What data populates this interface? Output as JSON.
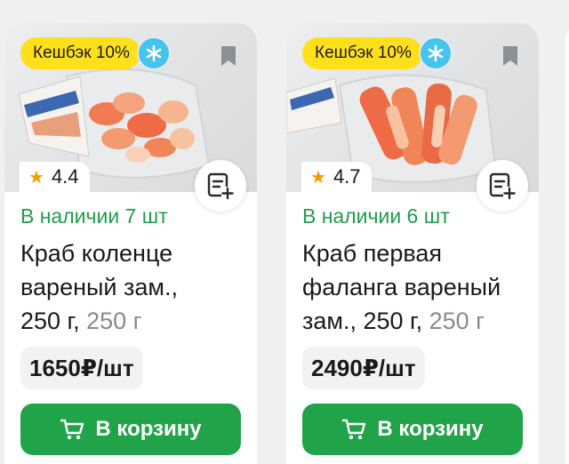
{
  "products": [
    {
      "cashback": "Кешбэк 10%",
      "rating": "4.4",
      "stock": "В наличии 7 шт",
      "title_lines": [
        "Краб коленце",
        "вареный зам.,"
      ],
      "title_tail": "250 г,",
      "weight": "250 г",
      "price": "1650₽/шт",
      "cart_label": "В корзину"
    },
    {
      "cashback": "Кешбэк 10%",
      "rating": "4.7",
      "stock": "В наличии 6 шт",
      "title_lines": [
        "Краб первая",
        "фаланга вареный"
      ],
      "title_tail": "зам., 250 г,",
      "weight": "250 г",
      "price": "2490₽/шт",
      "cart_label": "В корзину"
    }
  ],
  "colors": {
    "accent_green": "#21a449",
    "stock_green": "#1f9e4d",
    "cashback_yellow": "#ffe01b",
    "cashback_blue": "#45c4ee",
    "rating_star": "#f59b00"
  },
  "icons": {
    "cashback": "snowflake-icon",
    "bookmark": "bookmark-icon",
    "rating": "star-icon",
    "shopping_list": "add-to-list-icon",
    "cart": "cart-icon"
  }
}
